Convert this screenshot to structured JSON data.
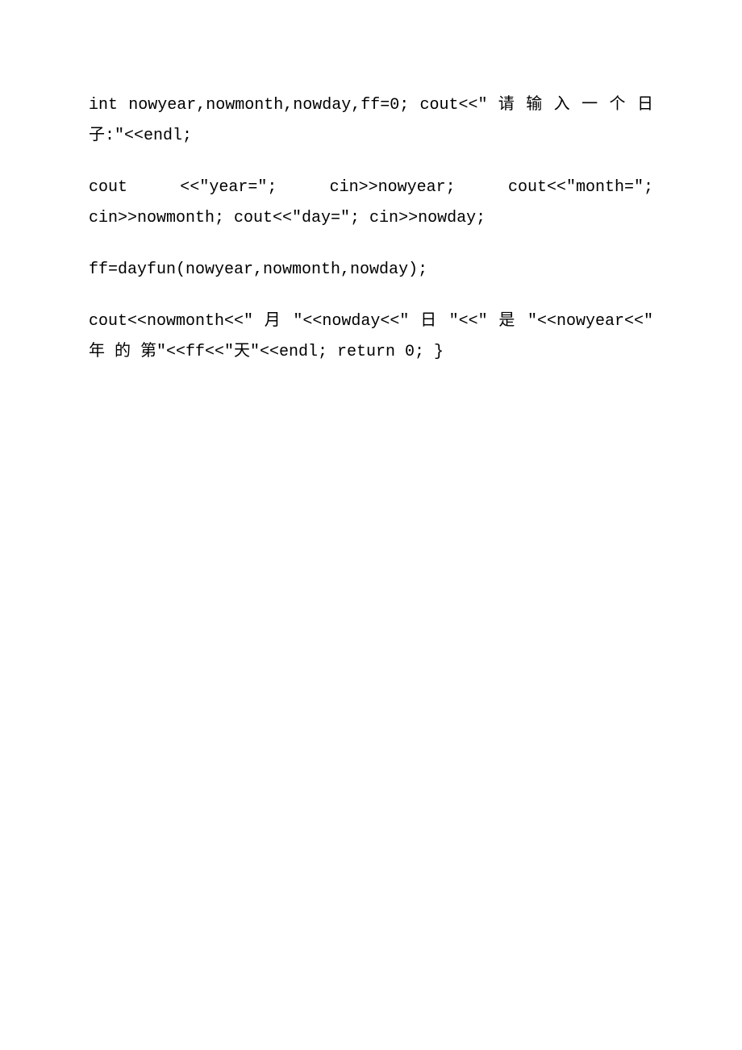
{
  "paragraphs": {
    "p1": " int nowyear,nowmonth,nowday,ff=0;   cout<<\" 请 输 入 一 个 日 子:\"<<endl;",
    "p2": " cout  <<\"year=\";      cin>>nowyear;       cout<<\"month=\";  cin>>nowmonth;   cout<<\"day=\";   cin>>nowday;",
    "p3": " ff=dayfun(nowyear,nowmonth,nowday);",
    "p4": " cout<<nowmonth<<\" 月 \"<<nowday<<\" 日 \"<<\" 是 \"<<nowyear<<\" 年 的 第\"<<ff<<\"天\"<<endl;  return 0;  }"
  }
}
